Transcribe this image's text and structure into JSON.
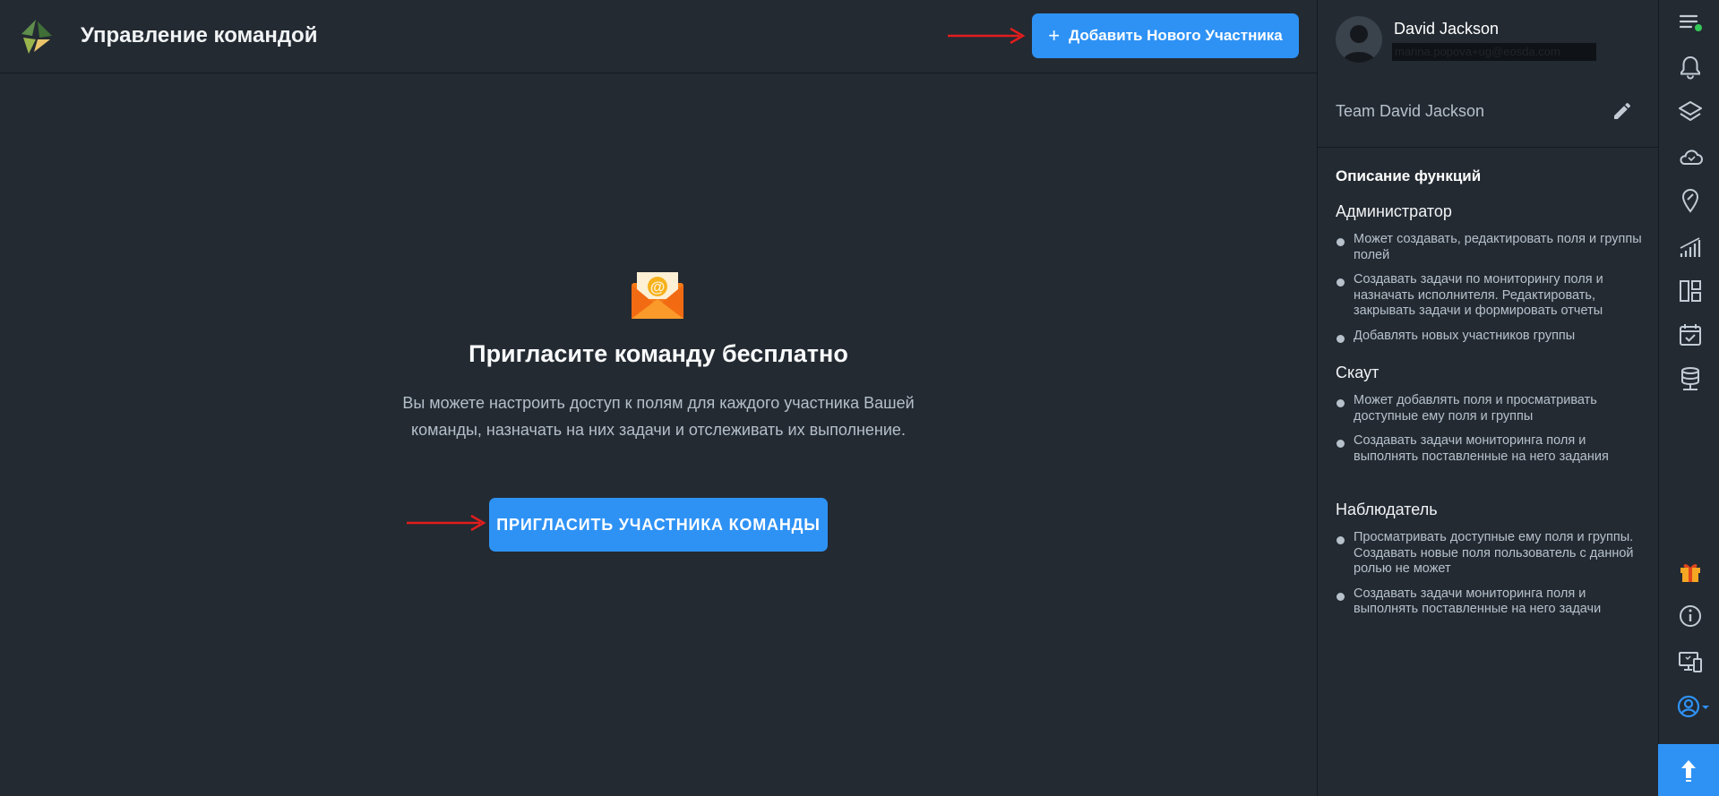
{
  "header": {
    "title": "Управление командой",
    "add_member_label": "Добавить Нового Участника",
    "add_member_icon": "plus-icon"
  },
  "main": {
    "title": "Пригласите команду бесплатно",
    "description": "Вы можете настроить доступ к полям для каждого участника Вашей команды, назначать на них задачи и отслеживать их выполнение.",
    "invite_button": "ПРИГЛАСИТЬ УЧАСТНИКА КОМАНДЫ",
    "icon": "envelope-at-icon"
  },
  "profile": {
    "name": "David Jackson",
    "email": "marina.popova+ug@eosda.com",
    "team": "Team David Jackson"
  },
  "functions": {
    "title": "Описание функций",
    "roles": [
      {
        "title": "Администратор",
        "items": [
          "Может создавать, редактировать поля и группы полей",
          "Создавать задачи по мониторингу поля и назначать исполнителя. Редактировать, закрывать задачи и формировать отчеты",
          "Добавлять новых участников группы"
        ]
      },
      {
        "title": "Скаут",
        "items": [
          "Может добавлять поля и просматривать доступные ему поля и группы",
          "Создавать задачи мониторинга поля и выполнять поставленные на него задания"
        ]
      },
      {
        "title": "Наблюдатель",
        "items": [
          "Просматривать доступные ему поля и группы. Создавать новые поля пользователь с данной ролью не может",
          "Создавать задачи мониторинга поля и выполнять поставленные на него задачи"
        ]
      }
    ]
  },
  "rail": {
    "icons": [
      "menu-icon",
      "bell-icon",
      "layers-icon",
      "cloud-icon",
      "location-icon",
      "chart-icon",
      "layout-icon",
      "calendar-check-icon",
      "database-icon",
      "gift-icon",
      "info-icon",
      "devices-icon",
      "account-icon",
      "upload-icon"
    ]
  },
  "colors": {
    "background": "#232a32",
    "accent": "#2e92f5",
    "arrow": "#e21d1d",
    "status_dot": "#35c85a"
  }
}
